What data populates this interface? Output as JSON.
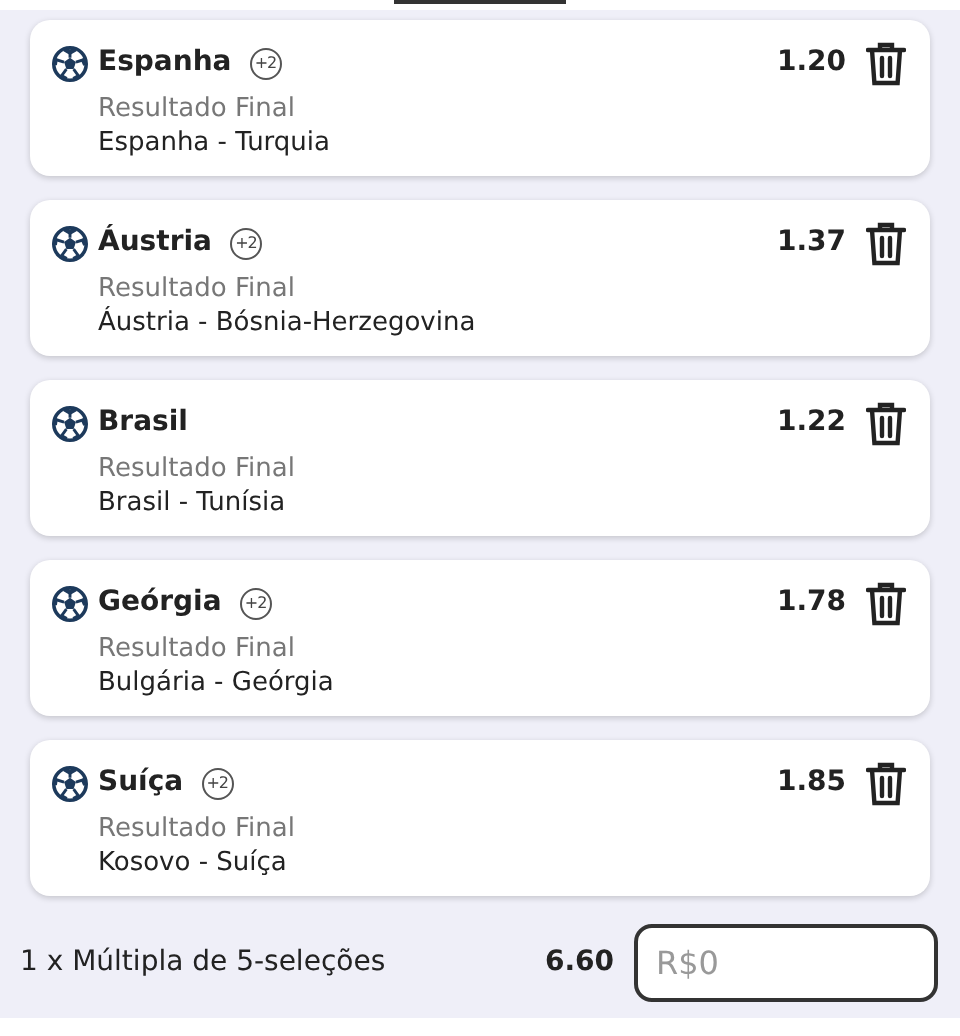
{
  "selections": [
    {
      "team": "Espanha",
      "badge": "+2",
      "market": "Resultado Final",
      "match": "Espanha - Turquia",
      "odds": "1.20"
    },
    {
      "team": "Áustria",
      "badge": "+2",
      "market": "Resultado Final",
      "match": "Áustria - Bósnia-Herzegovina",
      "odds": "1.37"
    },
    {
      "team": "Brasil",
      "market": "Resultado Final",
      "match": "Brasil - Tunísia",
      "odds": "1.22"
    },
    {
      "team": "Geórgia",
      "badge": "+2",
      "market": "Resultado Final",
      "match": "Bulgária - Geórgia",
      "odds": "1.78"
    },
    {
      "team": "Suíça",
      "badge": "+2",
      "market": "Resultado Final",
      "match": "Kosovo - Suíça",
      "odds": "1.85"
    }
  ],
  "summary": {
    "label": "1 x Múltipla de 5-seleções",
    "odds": "6.60",
    "stake": {
      "placeholder": "R$0"
    }
  }
}
